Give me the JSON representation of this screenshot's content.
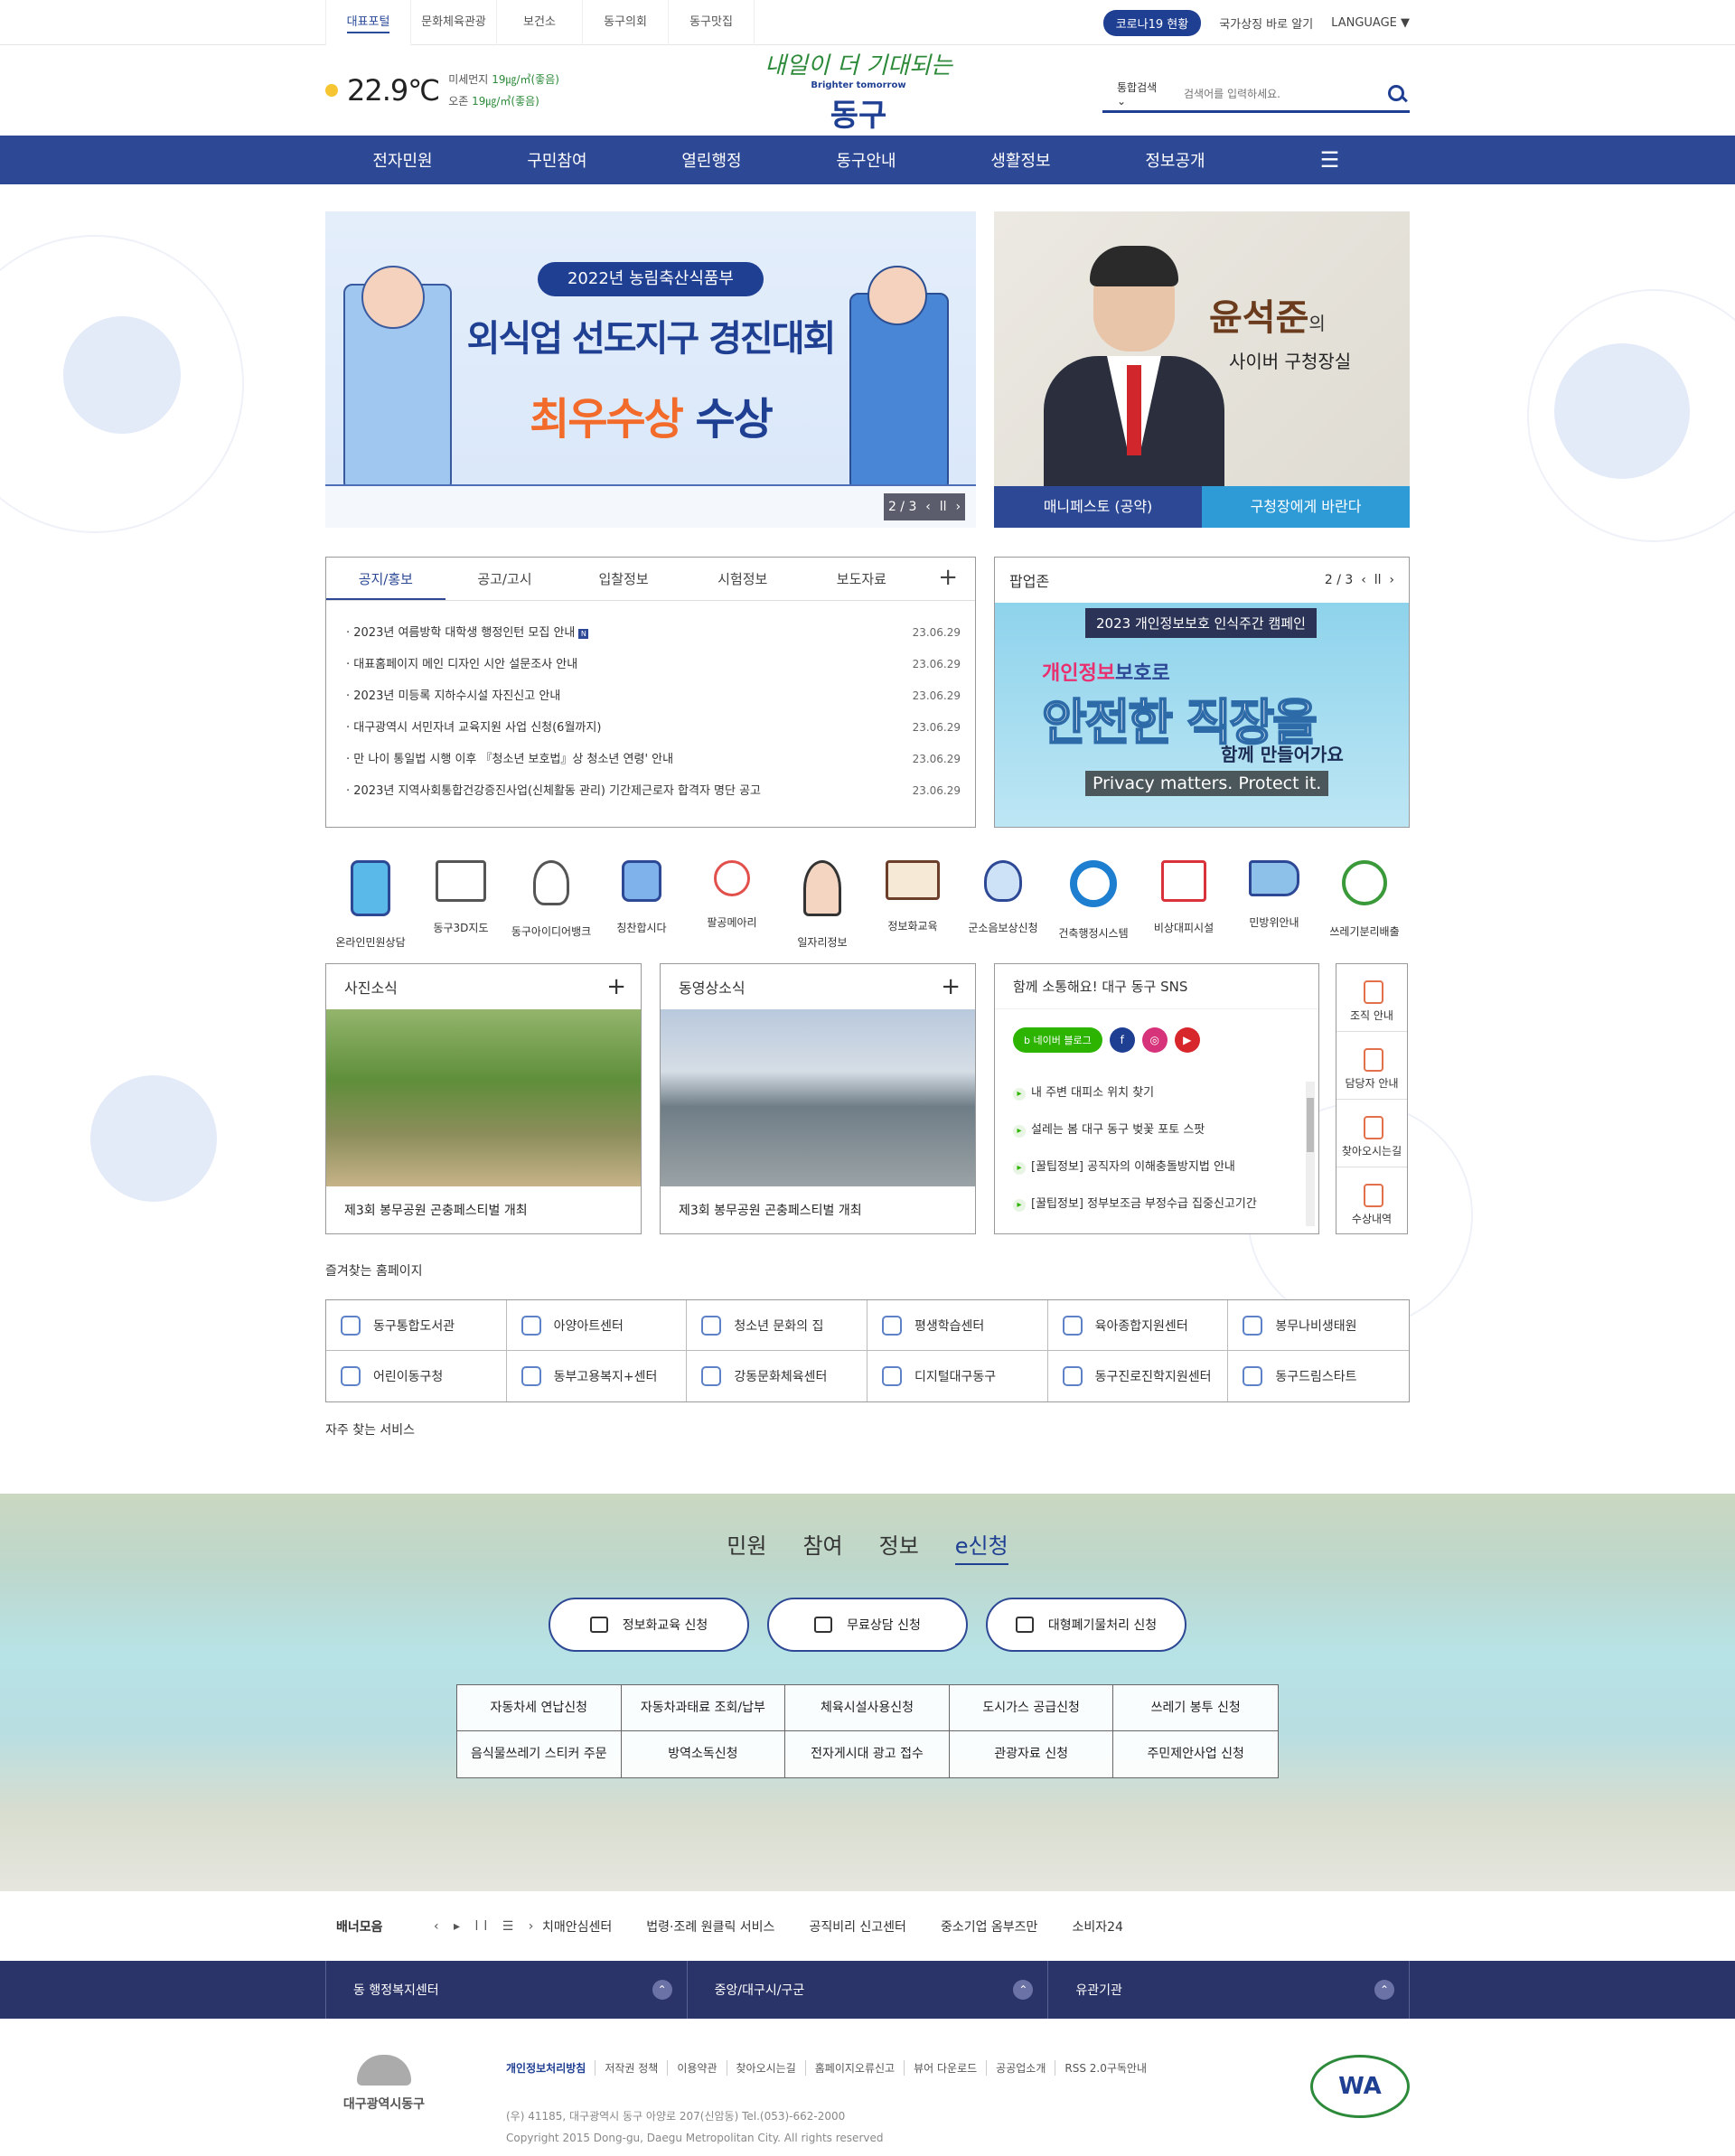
{
  "topbar": {
    "tabs": [
      "대표포털",
      "문화체육관광",
      "보건소",
      "동구의회",
      "동구맛집"
    ],
    "covid": "코로나19 현황",
    "gov": "국가상징 바로 알기",
    "language": "LANGUAGE ▼"
  },
  "weather": {
    "temp": "22.9℃",
    "dust1_label": "미세먼지",
    "dust1_value": "19㎍/㎥(좋음)",
    "dust2_label": "오존",
    "dust2_value": "19㎍/㎥(좋음)"
  },
  "logo": {
    "line1": "내일이 더 기대되는",
    "line2": "Brighter tomorrow",
    "line3": "동구"
  },
  "search": {
    "scope": "통합검색 ⌄",
    "placeholder": "검색어를 입력하세요."
  },
  "gnb": [
    "전자민원",
    "구민참여",
    "열린행정",
    "동구안내",
    "생활정보",
    "정보공개"
  ],
  "gnb_menu_icon": "☰",
  "main_banner": {
    "tag": "2022년 농림축산식품부",
    "title": "외식업 선도지구 경진대회",
    "award": "최우수상",
    "award_suffix": "수상",
    "counter": "2 / 3"
  },
  "mayor": {
    "name": "윤석준",
    "name_suffix": "의",
    "subtitle": "사이버 구청장실",
    "btn1": "매니페스토 (공약)",
    "btn2": "구청장에게 바란다"
  },
  "news": {
    "tabs": [
      "공지/홍보",
      "공고/고시",
      "입찰정보",
      "시험정보",
      "보도자료"
    ],
    "plus": "+",
    "items": [
      {
        "title": "2023년 여름방학 대학생 행정인턴 모집 안내",
        "date": "23.06.29"
      },
      {
        "title": "대표홈페이지 메인 디자인 시안 설문조사 안내",
        "date": "23.06.29"
      },
      {
        "title": "2023년 미등록 지하수시설 자진신고 안내",
        "date": "23.06.29"
      },
      {
        "title": "대구광역시 서민자녀 교육지원 사업 신청(6월까지)",
        "date": "23.06.29"
      },
      {
        "title": "만 나이 통일법 시행 이후 『청소년 보호법』상 청소년 연령' 안내",
        "date": "23.06.29"
      },
      {
        "title": "2023년 지역사회통합건강증진사업(신체활동 관리) 기간제근로자 합격자 명단 공고",
        "date": "23.06.29"
      }
    ],
    "new_badge": "N"
  },
  "popup": {
    "title": "팝업존",
    "counter": "2 / 3",
    "caption": "2023 개인정보보호 인식주간 캠페인",
    "line1a": "개인정보",
    "line1b": "보호로",
    "line2": "안전한 직장을",
    "line3": "함께 만들어가요",
    "eng": "Privacy matters. Protect it."
  },
  "quick": [
    {
      "label": "온라인민원상담",
      "icon": "chat-phone-icon"
    },
    {
      "label": "동구3D지도",
      "icon": "map-scroll-icon"
    },
    {
      "label": "동구아이디어뱅크",
      "icon": "lightbulb-icon"
    },
    {
      "label": "칭찬합시다",
      "icon": "thumbs-up-icon"
    },
    {
      "label": "팔공메아리",
      "icon": "touch-icon"
    },
    {
      "label": "일자리정보",
      "icon": "worker-icon"
    },
    {
      "label": "정보화교육",
      "icon": "book-icon"
    },
    {
      "label": "군소음보상신청",
      "icon": "money-bag-icon"
    },
    {
      "label": "건축행정시스템",
      "icon": "gear-icon"
    },
    {
      "label": "비상대피시설",
      "icon": "house-icon"
    },
    {
      "label": "민방위안내",
      "icon": "megaphone-icon"
    },
    {
      "label": "쓰레기분리배출",
      "icon": "recycle-icon"
    }
  ],
  "photo_news": {
    "title": "사진소식",
    "caption": "제3회 봉무공원 곤충페스티벌 개최",
    "plus": "+"
  },
  "video_news": {
    "title": "동영상소식",
    "caption": "제3회 봉무공원 곤충페스티벌 개최",
    "plus": "+"
  },
  "sns": {
    "title": "함께 소통해요! 대구 동구 SNS",
    "blog": "b 네이버 블로그",
    "facebook": "f",
    "instagram": "◎",
    "youtube": "▶",
    "items": [
      "내 주변 대피소 위치 찾기",
      "설레는 봄 대구 동구 벚꽃 포토 스팟",
      "[꿀팁정보] 공직자의 이해충돌방지법 안내",
      "[꿀팁정보] 정부보조금 부정수급 집중신고기간"
    ]
  },
  "side_links": [
    "조직 안내",
    "담당자 안내",
    "찾아오시는길",
    "수상내역"
  ],
  "favorites": {
    "title": "즐겨찾는 홈페이지",
    "items": [
      "동구통합도서관",
      "아양아트센터",
      "청소년 문화의 집",
      "평생학습센터",
      "육아종합지원센터",
      "봉무나비생태원",
      "어린이동구청",
      "동부고용복지+센터",
      "강동문화체육센터",
      "디지털대구동구",
      "동구진로진학지원센터",
      "동구드림스타트"
    ]
  },
  "services": {
    "title": "자주 찾는 서비스",
    "tabs": [
      "민원",
      "참여",
      "정보",
      "e신청"
    ],
    "pills": [
      "정보화교육 신청",
      "무료상담 신청",
      "대형폐기물처리 신청"
    ],
    "grid": [
      "자동차세 연납신청",
      "자동차과태료 조회/납부",
      "체육시설사용신청",
      "도시가스 공급신청",
      "쓰레기 봉투 신청",
      "음식물쓰레기 스티커 주문",
      "방역소독신청",
      "전자게시대 광고 접수",
      "관광자료 신청",
      "주민제안사업 신청"
    ]
  },
  "banner_strip": {
    "title": "배너모음",
    "controls": "‹ ▸ ll ☰ ›",
    "links": [
      "치매안심센터",
      "법령·조례 원클릭 서비스",
      "공직비리 신고센터",
      "중소기업 옴부즈만",
      "소비자24"
    ]
  },
  "dark_band": [
    "동 행정복지센터",
    "중앙/대구시/구군",
    "유관기관"
  ],
  "footer": {
    "org": "대구광역시동구",
    "links": [
      "개인정보처리방침",
      "저작권 정책",
      "이용약관",
      "찾아오시는길",
      "홈페이지오류신고",
      "뷰어 다운로드",
      "공공업소개",
      "RSS 2.0구독안내"
    ],
    "address": "(우) 41185, 대구광역시 동구 아양로 207(신암동) Tel.(053)-662-2000",
    "copyright": "Copyright 2015 Dong-gu, Daegu Metropolitan City. All rights reserved",
    "wa_mark": "WA"
  },
  "colors": {
    "primary": "#2d4895",
    "accent": "#2f9bd6",
    "green": "#2d8a3a"
  }
}
